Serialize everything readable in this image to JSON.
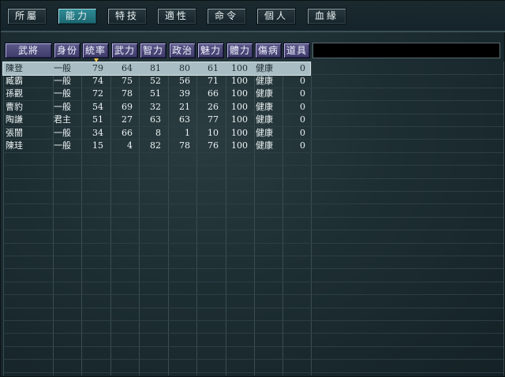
{
  "tabs": [
    {
      "label": "所屬"
    },
    {
      "label": "能力",
      "active": true
    },
    {
      "label": "特技"
    },
    {
      "label": "適性"
    },
    {
      "label": "命令"
    },
    {
      "label": "個人"
    },
    {
      "label": "血緣"
    }
  ],
  "columns": [
    "武將",
    "身份",
    "統率",
    "武力",
    "智力",
    "政治",
    "魅力",
    "體力",
    "傷病",
    "道具"
  ],
  "sort_column": "統率",
  "selected_row": 0,
  "rows": [
    {
      "name": "陳登",
      "status": "一般",
      "lead": "79",
      "war": "64",
      "int": "81",
      "pol": "80",
      "cha": "61",
      "hp": "100",
      "health": "健康",
      "item": "0"
    },
    {
      "name": "臧霸",
      "status": "一般",
      "lead": "74",
      "war": "75",
      "int": "52",
      "pol": "56",
      "cha": "71",
      "hp": "100",
      "health": "健康",
      "item": "0"
    },
    {
      "name": "孫觀",
      "status": "一般",
      "lead": "72",
      "war": "78",
      "int": "51",
      "pol": "39",
      "cha": "66",
      "hp": "100",
      "health": "健康",
      "item": "0"
    },
    {
      "name": "曹豹",
      "status": "一般",
      "lead": "54",
      "war": "69",
      "int": "32",
      "pol": "21",
      "cha": "26",
      "hp": "100",
      "health": "健康",
      "item": "0"
    },
    {
      "name": "陶謙",
      "status": "君主",
      "lead": "51",
      "war": "27",
      "int": "63",
      "pol": "63",
      "cha": "77",
      "hp": "100",
      "health": "健康",
      "item": "0"
    },
    {
      "name": "張闓",
      "status": "一般",
      "lead": "34",
      "war": "66",
      "int": "8",
      "pol": "1",
      "cha": "10",
      "hp": "100",
      "health": "健康",
      "item": "0"
    },
    {
      "name": "陳珪",
      "status": "一般",
      "lead": "15",
      "war": "4",
      "int": "82",
      "pol": "78",
      "cha": "76",
      "hp": "100",
      "health": "健康",
      "item": "0"
    }
  ]
}
